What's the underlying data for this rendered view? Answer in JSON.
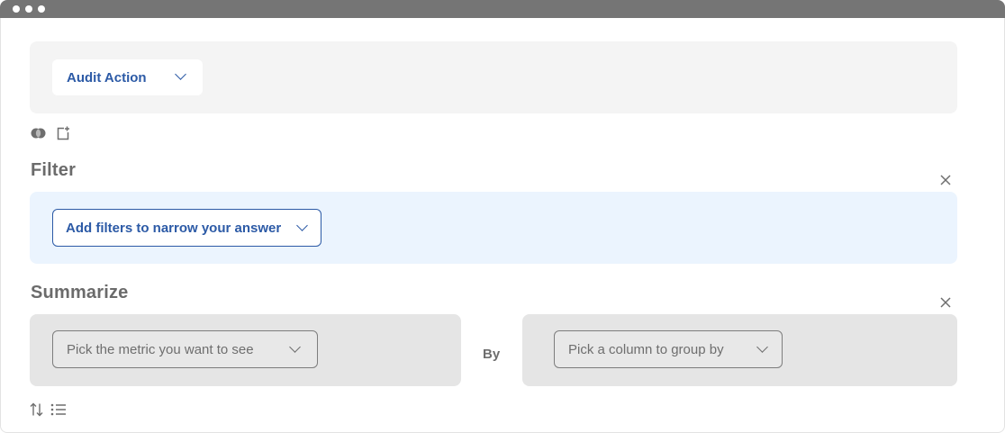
{
  "window": {
    "controls": [
      "window-dot",
      "window-dot",
      "window-dot"
    ]
  },
  "data_source": {
    "label": "Audit Action",
    "icon": "chevron-down-icon"
  },
  "toolbar": {
    "icons": [
      "join-icon",
      "custom-column-icon"
    ]
  },
  "filter": {
    "title": "Filter",
    "add_button_label": "Add filters to narrow your answer",
    "close_icon": "close-icon"
  },
  "summarize": {
    "title": "Summarize",
    "metric_placeholder": "Pick the metric you want to see",
    "by_label": "By",
    "group_placeholder": "Pick a column to group by",
    "close_icon": "close-icon"
  },
  "bottom_toolbar": {
    "icons": [
      "sort-icon",
      "row-limit-icon"
    ]
  },
  "colors": {
    "accent": "#2c5aa6",
    "filter_bg": "#ebf4fe",
    "summarize_bg": "#e5e5e5",
    "source_bg": "#f4f4f4",
    "titlebar": "#757575"
  }
}
